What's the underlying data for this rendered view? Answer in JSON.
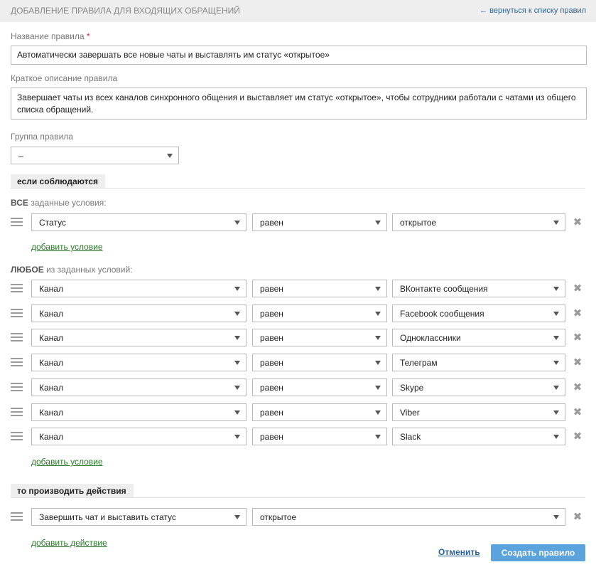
{
  "header": {
    "title": "ДОБАВЛЕНИЕ ПРАВИЛА ДЛЯ ВХОДЯЩИХ ОБРАЩЕНИЙ",
    "back_link": "← вернуться к списку правил"
  },
  "form": {
    "name_label": "Название правила",
    "required_mark": "*",
    "name_value": "Автоматически завершать все новые чаты и выставлять им статус «открытое»",
    "desc_label": "Краткое описание правила",
    "desc_value": "Завершает чаты из всех каналов синхронного общения и выставляет им статус «открытое», чтобы сотрудники работали с чатами из общего списка обращений.",
    "group_label": "Группа правила",
    "group_value": "–"
  },
  "conditions": {
    "section_title": "если соблюдаются",
    "all_label_strong": "ВСЕ",
    "all_label_rest": " заданные условия:",
    "all": [
      {
        "field": "Статус",
        "op": "равен",
        "value": "открытое"
      }
    ],
    "add_condition": "добавить условие",
    "any_label_strong": "ЛЮБОЕ",
    "any_label_rest": " из заданных условий:",
    "any": [
      {
        "field": "Канал",
        "op": "равен",
        "value": "ВКонтакте сообщения"
      },
      {
        "field": "Канал",
        "op": "равен",
        "value": "Facebook сообщения"
      },
      {
        "field": "Канал",
        "op": "равен",
        "value": "Одноклассники"
      },
      {
        "field": "Канал",
        "op": "равен",
        "value": "Телеграм"
      },
      {
        "field": "Канал",
        "op": "равен",
        "value": "Skype"
      },
      {
        "field": "Канал",
        "op": "равен",
        "value": "Viber"
      },
      {
        "field": "Канал",
        "op": "равен",
        "value": "Slack"
      }
    ]
  },
  "actions": {
    "section_title": "то производить действия",
    "items": [
      {
        "action": "Завершить чат и выставить статус",
        "value": "открытое"
      }
    ],
    "add_action": "добавить действие"
  },
  "buttons": {
    "cancel": "Отменить",
    "submit": "Создать правило"
  },
  "colors": {
    "accent": "#5aa3dc",
    "link": "#2a6496",
    "add_link": "#2b7a2b",
    "required": "#e0232a"
  }
}
